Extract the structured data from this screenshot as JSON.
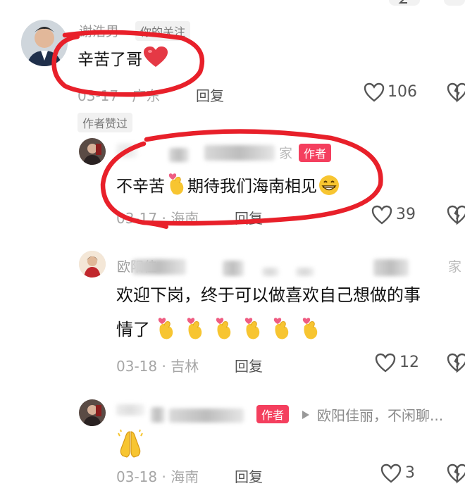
{
  "comments": [
    {
      "name": "谢浩男",
      "tag": "你的关注",
      "text": "辛苦了哥",
      "date": "03-17",
      "location": "广东",
      "reply_label": "回复",
      "likes": "106",
      "badge": "作者赞过"
    },
    {
      "name_suffix": "家",
      "author_tag": "作者",
      "text_a": "不辛苦",
      "text_b": "期待我们海南相见",
      "date": "03-17",
      "location": "海南",
      "reply_label": "回复",
      "likes": "39"
    },
    {
      "name": "欧阳佳",
      "name_suffix": "家",
      "text_line1": "欢迎下岗，终于可以做喜欢自己想做的事",
      "text_line2": "情了",
      "date": "03-18",
      "location": "吉林",
      "reply_label": "回复",
      "likes": "12"
    },
    {
      "author_tag": "作者",
      "reply_to": "欧阳佳丽，不闲聊...",
      "date": "03-18",
      "location": "海南",
      "reply_label": "回复",
      "likes": "3"
    }
  ],
  "colors": {
    "annotation_red": "#e8202a",
    "author_tag": "#f43f5e"
  },
  "icons": [
    "heart-outline-icon",
    "broken-heart-icon",
    "red-heart-emoji",
    "finger-heart-emoji",
    "grin-emoji",
    "praying-hands-emoji"
  ]
}
